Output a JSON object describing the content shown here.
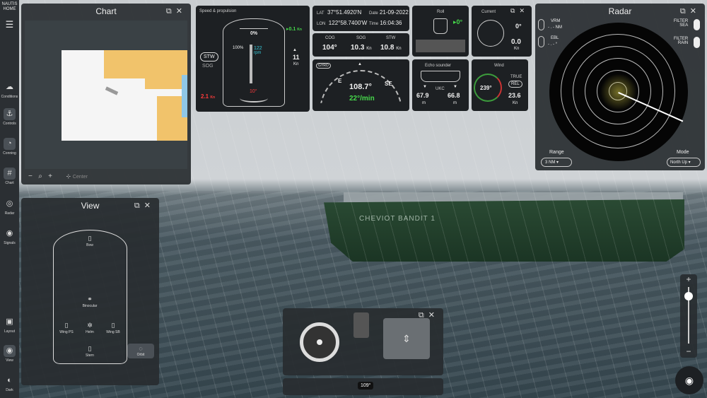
{
  "rail": {
    "home": "NAUTIS\nHOME",
    "items": [
      {
        "label": "Conditions",
        "icon": "conditions-icon",
        "glyph": "☁"
      },
      {
        "label": "Controls",
        "icon": "controls-icon",
        "glyph": "⚓"
      },
      {
        "label": "Conning",
        "icon": "conning-icon",
        "glyph": "◔"
      },
      {
        "label": "Chart",
        "icon": "chart-icon",
        "glyph": "#"
      },
      {
        "label": "Radar",
        "icon": "radar-icon",
        "glyph": "◎"
      },
      {
        "label": "Signals",
        "icon": "signals-icon",
        "glyph": "◉"
      },
      {
        "label": "Layout",
        "icon": "layout-icon",
        "glyph": "▣"
      },
      {
        "label": "View",
        "icon": "view-icon",
        "glyph": "◉"
      },
      {
        "label": "Dark",
        "icon": "dark-icon",
        "glyph": "◐"
      }
    ]
  },
  "chart_panel": {
    "title": "Chart",
    "center_label": "Center"
  },
  "speed": {
    "label": "Speed & propulsion",
    "top_value": "0%",
    "throttle_pct": "100%",
    "rpm_value": "122",
    "rpm_unit": "rpm",
    "stw_btn": "STW",
    "sog_lbl": "SOG",
    "fwd_speed": "0.1",
    "fwd_unit": "Kn",
    "speed_big": "11",
    "speed_unit": "Kn",
    "lat_speed": "2.1",
    "lat_unit": "Kn",
    "rudder": "10°"
  },
  "position": {
    "lat_lbl": "LAT",
    "lat": "37°51.4920'N",
    "date_lbl": "Date",
    "date": "21-09-2022",
    "lon_lbl": "LON",
    "lon": "122°58.7400'W",
    "time_lbl": "Time",
    "time": "16:04:36"
  },
  "motion": {
    "cog_lbl": "COG",
    "cog": "104°",
    "sog_lbl": "SOG",
    "sog": "10.3",
    "sog_unit": "Kn",
    "stw_lbl": "STW",
    "stw": "10.8",
    "stw_unit": "Kn"
  },
  "heading": {
    "badge": "GYRO",
    "value": "108.7°",
    "rot": "22°/min",
    "e": "E",
    "se": "SE"
  },
  "roll": {
    "label": "Roll",
    "value": "0°"
  },
  "current": {
    "label": "Current",
    "dir": "0°",
    "speed": "0.0",
    "unit": "Kn"
  },
  "echo": {
    "label": "Echo sounder",
    "ukc": "UKC",
    "left": "67.9",
    "right": "66.8",
    "unit": "m"
  },
  "wind": {
    "label": "Wind",
    "true_lbl": "TRUE",
    "rel_btn": "REL",
    "dir": "239°",
    "speed": "23.6",
    "unit": "Kn"
  },
  "radar": {
    "title": "Radar",
    "vrm": "VRM",
    "vrm_val": "- . - NM",
    "ebl": "EBL",
    "ebl_val": "- . - °",
    "filter_sea": "FILTER\nSEA",
    "filter_rain": "FILTER\nRAIN",
    "range_lbl": "Range",
    "range": "3 NM",
    "mode_lbl": "Mode",
    "mode": "North Up"
  },
  "view": {
    "title": "View",
    "bow": "Bow",
    "binocular": "Binocular",
    "wing_ps": "Wing PS",
    "helm": "Helm",
    "wing_sb": "Wing SB",
    "stern": "Stern",
    "orbit": "Orbit"
  },
  "ship_name": "CHEVIOT BANDIT 1",
  "compass": {
    "heading": "109°"
  }
}
